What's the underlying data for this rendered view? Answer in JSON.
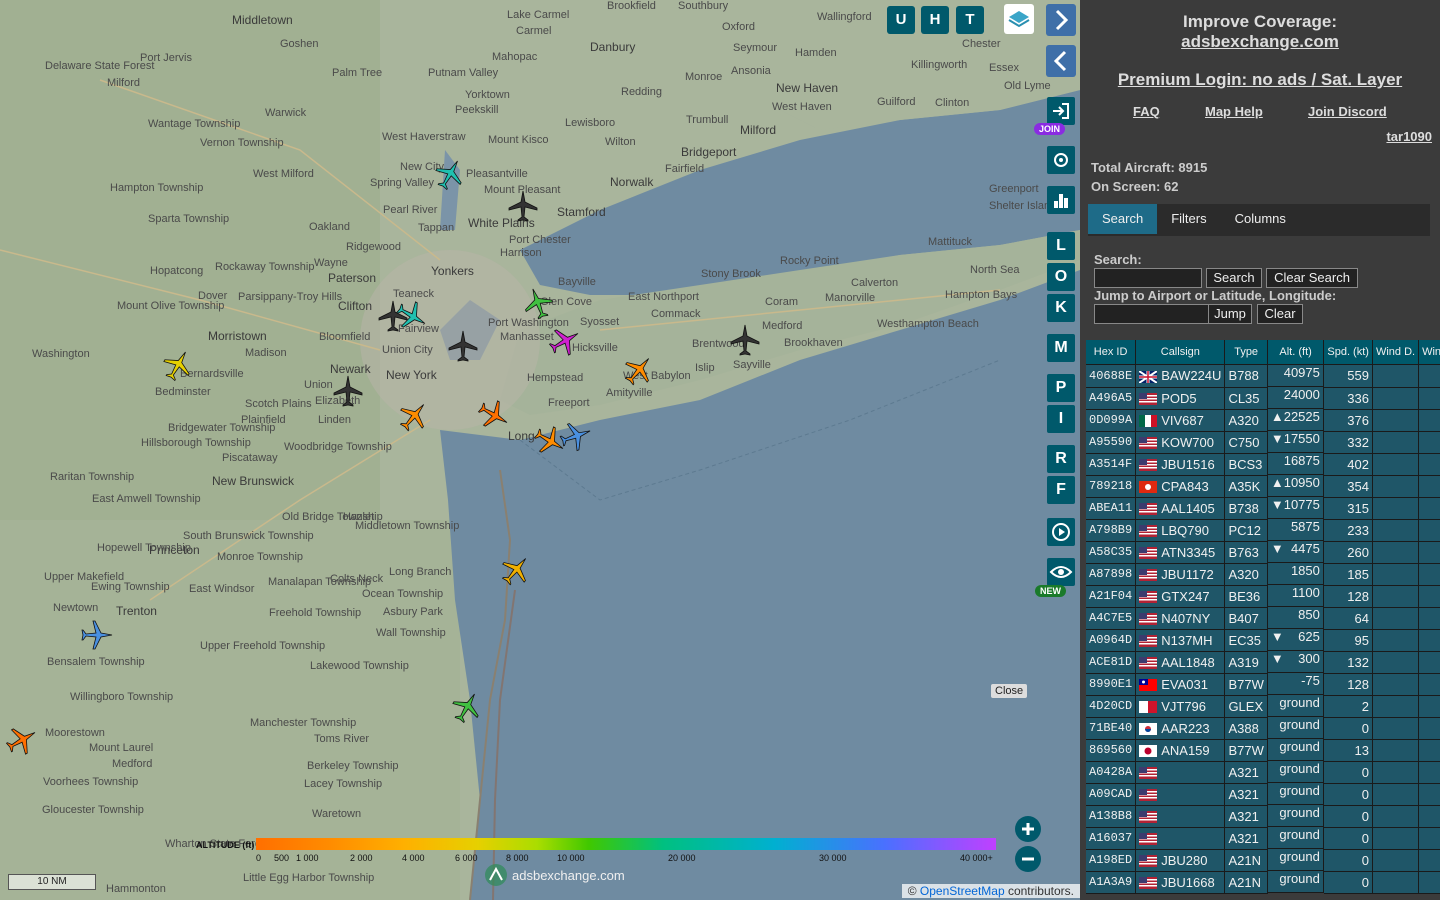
{
  "map": {
    "places": [
      {
        "name": "Middletown",
        "big": true
      },
      {
        "name": "Goshen"
      },
      {
        "name": "Port Jervis"
      },
      {
        "name": "Delaware State Forest"
      },
      {
        "name": "Milford"
      },
      {
        "name": "Warwick"
      },
      {
        "name": "Wantage Township"
      },
      {
        "name": "Vernon Township"
      },
      {
        "name": "Hampton Township"
      },
      {
        "name": "West Milford"
      },
      {
        "name": "Sparta Township"
      },
      {
        "name": "Hopatcong"
      },
      {
        "name": "Rockaway Township"
      },
      {
        "name": "Dover"
      },
      {
        "name": "Mount Olive Township"
      },
      {
        "name": "Morristown",
        "big": true
      },
      {
        "name": "Washington"
      },
      {
        "name": "Bernardsville"
      },
      {
        "name": "Bedminster"
      },
      {
        "name": "Bridgewater Township"
      },
      {
        "name": "Raritan Township"
      },
      {
        "name": "Hillsborough Township"
      },
      {
        "name": "East Amwell Township"
      },
      {
        "name": "New Brunswick",
        "big": true
      },
      {
        "name": "Princeton",
        "big": true
      },
      {
        "name": "Hopewell Township"
      },
      {
        "name": "Upper Makefield"
      },
      {
        "name": "Newtown"
      },
      {
        "name": "Trenton",
        "big": true
      },
      {
        "name": "Bensalem Township"
      },
      {
        "name": "Willingboro Township"
      },
      {
        "name": "Moorestown"
      },
      {
        "name": "Mount Laurel"
      },
      {
        "name": "Medford"
      },
      {
        "name": "Voorhees Township"
      },
      {
        "name": "Gloucester Township"
      },
      {
        "name": "Lake Carmel"
      },
      {
        "name": "Carmel"
      },
      {
        "name": "Mahopac"
      },
      {
        "name": "Putnam Valley"
      },
      {
        "name": "Palm Tree"
      },
      {
        "name": "Danbury",
        "big": true
      },
      {
        "name": "Brookfield"
      },
      {
        "name": "Southbury"
      },
      {
        "name": "Oxford"
      },
      {
        "name": "Seymour"
      },
      {
        "name": "Wallingford"
      },
      {
        "name": "Hamden"
      },
      {
        "name": "New Haven",
        "big": true
      },
      {
        "name": "West Haven"
      },
      {
        "name": "Milford",
        "big": true
      },
      {
        "name": "Bridgeport",
        "big": true
      },
      {
        "name": "Fairfield"
      },
      {
        "name": "Norwalk",
        "big": true
      },
      {
        "name": "Stamford",
        "big": true
      },
      {
        "name": "White Plains",
        "big": true
      },
      {
        "name": "Yonkers",
        "big": true
      },
      {
        "name": "Paterson",
        "big": true
      },
      {
        "name": "Clifton",
        "big": true
      },
      {
        "name": "Newark",
        "big": true
      },
      {
        "name": "New York",
        "big": true
      },
      {
        "name": "Hempstead"
      },
      {
        "name": "Freeport"
      },
      {
        "name": "Long",
        "big": true
      },
      {
        "name": "Bayville"
      },
      {
        "name": "Glen Cove"
      },
      {
        "name": "Syosset"
      },
      {
        "name": "Hicksville"
      },
      {
        "name": "East Northport"
      },
      {
        "name": "Commack"
      },
      {
        "name": "Stony Brook"
      },
      {
        "name": "Rocky Point"
      },
      {
        "name": "Coram"
      },
      {
        "name": "Medford"
      },
      {
        "name": "Brentwood"
      },
      {
        "name": "Islip"
      },
      {
        "name": "West Babylon"
      },
      {
        "name": "Amityville"
      },
      {
        "name": "Sayville"
      },
      {
        "name": "Brookhaven"
      },
      {
        "name": "Manorville"
      },
      {
        "name": "Calverton"
      },
      {
        "name": "Westhampton Beach"
      },
      {
        "name": "Hampton Bays"
      },
      {
        "name": "Mattituck"
      },
      {
        "name": "North Sea"
      },
      {
        "name": "Greenport"
      },
      {
        "name": "Shelter Island"
      },
      {
        "name": "Old Lyme"
      },
      {
        "name": "Essex"
      },
      {
        "name": "Chester"
      },
      {
        "name": "Killingworth"
      },
      {
        "name": "Clinton"
      },
      {
        "name": "Guilford"
      },
      {
        "name": "Trumbull"
      },
      {
        "name": "Monroe"
      },
      {
        "name": "Ansonia"
      },
      {
        "name": "Redding"
      },
      {
        "name": "Lewisboro"
      },
      {
        "name": "Wilton"
      },
      {
        "name": "Yorktown"
      },
      {
        "name": "Peekskill"
      },
      {
        "name": "Mount Kisco"
      },
      {
        "name": "West Haverstraw"
      },
      {
        "name": "New City"
      },
      {
        "name": "Spring Valley"
      },
      {
        "name": "Pearl River"
      },
      {
        "name": "Pleasantville"
      },
      {
        "name": "Mount Pleasant"
      },
      {
        "name": "Tappan"
      },
      {
        "name": "Oakland"
      },
      {
        "name": "Ridgewood"
      },
      {
        "name": "Wayne"
      },
      {
        "name": "Parsippany-Troy Hills"
      },
      {
        "name": "Bloomfield"
      },
      {
        "name": "Madison"
      },
      {
        "name": "Union City"
      },
      {
        "name": "Fairview"
      },
      {
        "name": "Teaneck"
      },
      {
        "name": "Union"
      },
      {
        "name": "Elizabeth"
      },
      {
        "name": "Linden"
      },
      {
        "name": "Scotch Plains"
      },
      {
        "name": "Plainfield"
      },
      {
        "name": "Woodbridge Township"
      },
      {
        "name": "Piscataway"
      },
      {
        "name": "Old Bridge Township"
      },
      {
        "name": "Hazlet"
      },
      {
        "name": "Middletown Township"
      },
      {
        "name": "Long Branch"
      },
      {
        "name": "Colts Neck"
      },
      {
        "name": "Manalapan Township"
      },
      {
        "name": "Freehold Township"
      },
      {
        "name": "Ocean Township"
      },
      {
        "name": "Asbury Park"
      },
      {
        "name": "Wall Township"
      },
      {
        "name": "Upper Freehold Township"
      },
      {
        "name": "Lakewood Township"
      },
      {
        "name": "Manchester Township"
      },
      {
        "name": "Toms River"
      },
      {
        "name": "Berkeley Township"
      },
      {
        "name": "Lacey Township"
      },
      {
        "name": "Waretown"
      },
      {
        "name": "Little Egg Harbor Township"
      },
      {
        "name": "Hammonton"
      },
      {
        "name": "Wharton State Forest"
      },
      {
        "name": "South Brunswick Township"
      },
      {
        "name": "Monroe Township"
      },
      {
        "name": "East Windsor"
      },
      {
        "name": "Ewing Township"
      },
      {
        "name": "Port Chester"
      },
      {
        "name": "Harrison"
      },
      {
        "name": "Manhasset"
      },
      {
        "name": "Port Washington"
      }
    ],
    "legend": {
      "title": "ALTITUDE (ft)",
      "ticks": [
        "0",
        "500",
        "1 000",
        "2 000",
        "4 000",
        "6 000",
        "8 000",
        "10 000",
        "20 000",
        "30 000",
        "40 000+"
      ]
    },
    "scale_label": "10 NM",
    "watermark": "adsbexchange.com",
    "attribution_prefix": "© ",
    "attribution_link": "OpenStreetMap",
    "attribution_suffix": " contributors.",
    "close_label": "Close",
    "top_buttons": [
      "U",
      "H",
      "T"
    ],
    "side_buttons": [
      "L",
      "O",
      "K",
      "M",
      "P",
      "I",
      "R",
      "F"
    ],
    "join_badge": "JOIN",
    "new_badge": "NEW"
  },
  "sidebar": {
    "improve_line1": "Improve Coverage:",
    "improve_link": "adsbexchange.com",
    "premium_link": "Premium Login: no ads / Sat. Layer",
    "links": [
      "FAQ",
      "Map Help",
      "Join Discord"
    ],
    "user_link": "tar1090",
    "total_label": "Total Aircraft: 8915",
    "onscreen_label": "On Screen: 62",
    "tabs": [
      "Search",
      "Filters",
      "Columns"
    ],
    "search_label": "Search:",
    "search_button": "Search",
    "clear_search_button": "Clear Search",
    "jump_label": "Jump to Airport or Latitude, Longitude:",
    "jump_button": "Jump",
    "clear_button": "Clear",
    "columns": [
      "Hex ID",
      "Callsign",
      "Type",
      "Alt. (ft)",
      "Spd. (kt)",
      "Wind D.",
      "Wind"
    ],
    "rows": [
      {
        "hex": "40688E",
        "flag": "gb",
        "callsign": "BAW224U",
        "type": "B788",
        "alt": "40975",
        "trend": "",
        "spd": "559"
      },
      {
        "hex": "A496A5",
        "flag": "us",
        "callsign": "POD5",
        "type": "CL35",
        "alt": "24000",
        "trend": "",
        "spd": "336"
      },
      {
        "hex": "0D099A",
        "flag": "mx",
        "callsign": "VIV687",
        "type": "A320",
        "alt": "22525",
        "trend": "▲",
        "spd": "376"
      },
      {
        "hex": "A95590",
        "flag": "us",
        "callsign": "KOW700",
        "type": "C750",
        "alt": "17550",
        "trend": "▼",
        "spd": "332"
      },
      {
        "hex": "A3514F",
        "flag": "us",
        "callsign": "JBU1516",
        "type": "BCS3",
        "alt": "16875",
        "trend": "",
        "spd": "402"
      },
      {
        "hex": "789218",
        "flag": "hk",
        "callsign": "CPA843",
        "type": "A35K",
        "alt": "10950",
        "trend": "▲",
        "spd": "354"
      },
      {
        "hex": "ABEA11",
        "flag": "us",
        "callsign": "AAL1405",
        "type": "B738",
        "alt": "10775",
        "trend": "▼",
        "spd": "315"
      },
      {
        "hex": "A798B9",
        "flag": "us",
        "callsign": "LBQ790",
        "type": "PC12",
        "alt": "5875",
        "trend": "",
        "spd": "233"
      },
      {
        "hex": "A58C35",
        "flag": "us",
        "callsign": "ATN3345",
        "type": "B763",
        "alt": "4475",
        "trend": "▼",
        "spd": "260"
      },
      {
        "hex": "A87898",
        "flag": "us",
        "callsign": "JBU1172",
        "type": "A320",
        "alt": "1850",
        "trend": "",
        "spd": "185"
      },
      {
        "hex": "A21F04",
        "flag": "us",
        "callsign": "GTX247",
        "type": "BE36",
        "alt": "1100",
        "trend": "",
        "spd": "128"
      },
      {
        "hex": "A4C7E5",
        "flag": "us",
        "callsign": "N407NY",
        "type": "B407",
        "alt": "850",
        "trend": "",
        "spd": "64"
      },
      {
        "hex": "A0964D",
        "flag": "us",
        "callsign": "N137MH",
        "type": "EC35",
        "alt": "625",
        "trend": "▼",
        "spd": "95"
      },
      {
        "hex": "ACE81D",
        "flag": "us",
        "callsign": "AAL1848",
        "type": "A319",
        "alt": "300",
        "trend": "▼",
        "spd": "132"
      },
      {
        "hex": "8990E1",
        "flag": "tw",
        "callsign": "EVA031",
        "type": "B77W",
        "alt": "-75",
        "trend": "",
        "spd": "128"
      },
      {
        "hex": "4D20CD",
        "flag": "mt",
        "callsign": "VJT796",
        "type": "GLEX",
        "alt": "ground",
        "trend": "",
        "spd": "2"
      },
      {
        "hex": "71BE40",
        "flag": "kr",
        "callsign": "AAR223",
        "type": "A388",
        "alt": "ground",
        "trend": "",
        "spd": "0"
      },
      {
        "hex": "869560",
        "flag": "jp",
        "callsign": "ANA159",
        "type": "B77W",
        "alt": "ground",
        "trend": "",
        "spd": "13"
      },
      {
        "hex": "A0428A",
        "flag": "us",
        "callsign": "",
        "type": "A321",
        "alt": "ground",
        "trend": "",
        "spd": "0"
      },
      {
        "hex": "A09CAD",
        "flag": "us",
        "callsign": "",
        "type": "A321",
        "alt": "ground",
        "trend": "",
        "spd": "0"
      },
      {
        "hex": "A138B8",
        "flag": "us",
        "callsign": "",
        "type": "A321",
        "alt": "ground",
        "trend": "",
        "spd": "0"
      },
      {
        "hex": "A16037",
        "flag": "us",
        "callsign": "",
        "type": "A321",
        "alt": "ground",
        "trend": "",
        "spd": "0"
      },
      {
        "hex": "A198ED",
        "flag": "us",
        "callsign": "JBU280",
        "type": "A21N",
        "alt": "ground",
        "trend": "",
        "spd": "0"
      },
      {
        "hex": "A1A3A9",
        "flag": "us",
        "callsign": "JBU1668",
        "type": "A21N",
        "alt": "ground",
        "trend": "",
        "spd": "0"
      }
    ]
  },
  "colors": {
    "accent": "#00596b",
    "water": "#6e8aa0",
    "land": "#a8b59a",
    "sidebar": "#3b3b3b",
    "row": "#1f5668"
  }
}
